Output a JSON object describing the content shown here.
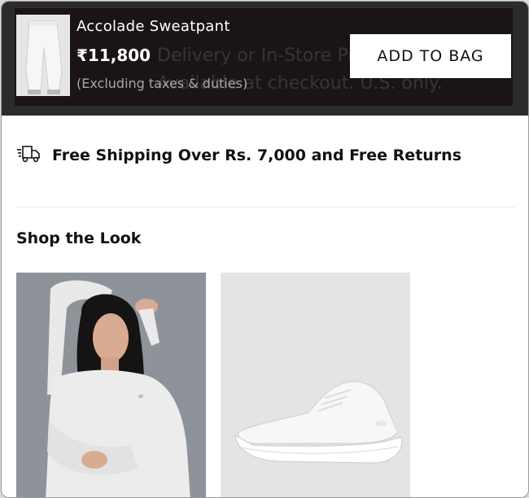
{
  "sticky_bar": {
    "product_name": "Accolade Sweatpant",
    "price": "₹11,800",
    "tax_note": "(Excluding taxes & duties)",
    "add_to_bag_label": "ADD TO BAG",
    "thumbnail_icon": "sweatpant-thumbnail"
  },
  "shipping": {
    "icon": "delivery-truck-icon",
    "text": "Free Shipping Over Rs. 7,000 and Free Returns"
  },
  "shop_the_look": {
    "title": "Shop the Look",
    "items": [
      {
        "icon": "model-in-sweatshirt-image"
      },
      {
        "icon": "white-sneaker-image"
      }
    ]
  }
}
